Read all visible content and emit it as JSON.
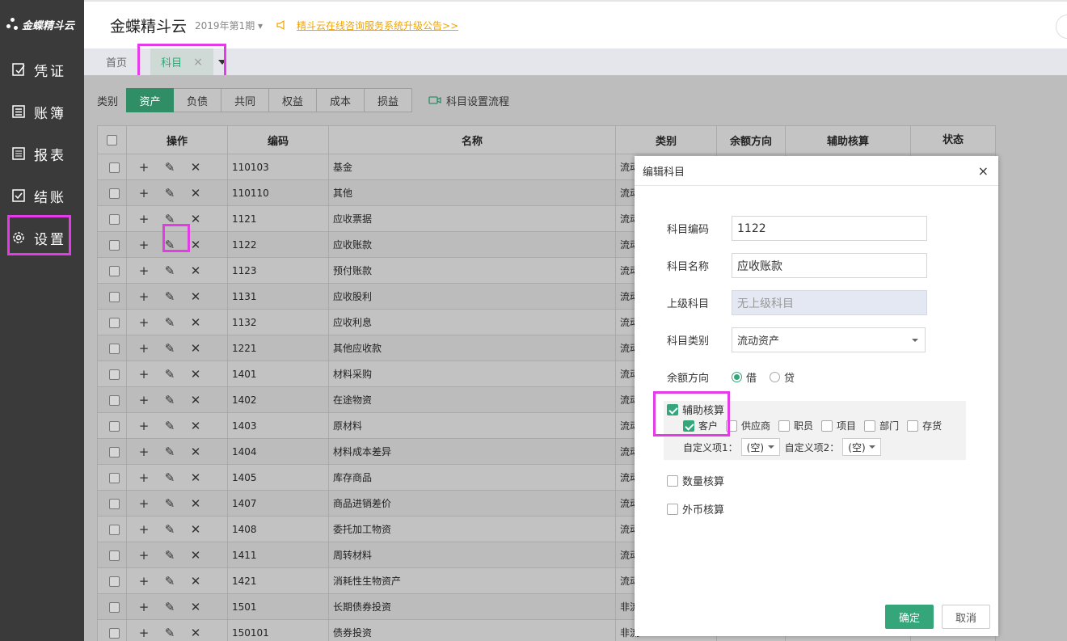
{
  "sidebar": {
    "logo": "金蝶精斗云",
    "items": [
      {
        "label": "凭证",
        "icon": "voucher-icon"
      },
      {
        "label": "账簿",
        "icon": "ledger-icon"
      },
      {
        "label": "报表",
        "icon": "report-icon"
      },
      {
        "label": "结账",
        "icon": "checkout-icon"
      },
      {
        "label": "设置",
        "icon": "gear-icon"
      }
    ]
  },
  "header": {
    "brand": "金蝶精斗云",
    "period": "2019年第1期",
    "notice": "精斗云在线咨询服务系统升级公告>>"
  },
  "tabs": {
    "home": "首页",
    "active": "科目",
    "close": "×"
  },
  "category": {
    "label": "类别",
    "buttons": [
      "资产",
      "负债",
      "共同",
      "权益",
      "成本",
      "损益"
    ],
    "active": "资产",
    "flow": "科目设置流程"
  },
  "table": {
    "headers": [
      "操作",
      "编码",
      "名称",
      "类别",
      "余额方向",
      "辅助核算",
      "状态"
    ],
    "rows": [
      {
        "code": "110103",
        "name": "基金",
        "type": "流动",
        "indent": true
      },
      {
        "code": "110110",
        "name": "其他",
        "type": "流动",
        "indent": true
      },
      {
        "code": "1121",
        "name": "应收票据",
        "type": "流动"
      },
      {
        "code": "1122",
        "name": "应收账款",
        "type": "流动"
      },
      {
        "code": "1123",
        "name": "预付账款",
        "type": "流动"
      },
      {
        "code": "1131",
        "name": "应收股利",
        "type": "流动"
      },
      {
        "code": "1132",
        "name": "应收利息",
        "type": "流动"
      },
      {
        "code": "1221",
        "name": "其他应收款",
        "type": "流动"
      },
      {
        "code": "1401",
        "name": "材料采购",
        "type": "流动"
      },
      {
        "code": "1402",
        "name": "在途物资",
        "type": "流动"
      },
      {
        "code": "1403",
        "name": "原材料",
        "type": "流动"
      },
      {
        "code": "1404",
        "name": "材料成本差异",
        "type": "流动"
      },
      {
        "code": "1405",
        "name": "库存商品",
        "type": "流动"
      },
      {
        "code": "1407",
        "name": "商品进销差价",
        "type": "流动"
      },
      {
        "code": "1408",
        "name": "委托加工物资",
        "type": "流动"
      },
      {
        "code": "1411",
        "name": "周转材料",
        "type": "流动"
      },
      {
        "code": "1421",
        "name": "消耗性生物资产",
        "type": "流动"
      },
      {
        "code": "1501",
        "name": "长期债券投资",
        "type": "非流"
      },
      {
        "code": "150101",
        "name": "债券投资",
        "type": "非流",
        "indent": true
      }
    ]
  },
  "modal": {
    "title": "编辑科目",
    "close": "×",
    "code_label": "科目编码",
    "code_value": "1122",
    "name_label": "科目名称",
    "name_value": "应收账款",
    "parent_label": "上级科目",
    "parent_placeholder": "无上级科目",
    "type_label": "科目类别",
    "type_value": "流动资产",
    "direction_label": "余额方向",
    "direction_debit": "借",
    "direction_credit": "贷",
    "aux_label": "辅助核算",
    "aux_items": [
      {
        "label": "客户",
        "checked": true
      },
      {
        "label": "供应商",
        "checked": false
      },
      {
        "label": "职员",
        "checked": false
      },
      {
        "label": "项目",
        "checked": false
      },
      {
        "label": "部门",
        "checked": false
      },
      {
        "label": "存货",
        "checked": false
      }
    ],
    "custom1_label": "自定义项1：",
    "custom1_value": "(空)",
    "custom2_label": "自定义项2：",
    "custom2_value": "(空)",
    "qty_label": "数量核算",
    "fx_label": "外币核算",
    "ok": "确定",
    "cancel": "取消"
  },
  "colors": {
    "accent": "#35a57a",
    "highlight": "#e33be6",
    "sidebar": "#3a3a3a",
    "notice": "#f0a500"
  }
}
